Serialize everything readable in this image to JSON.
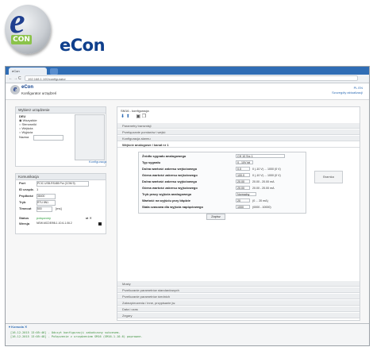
{
  "brand": {
    "logo_letter": "e",
    "logo_badge": "CON",
    "name": "eCon"
  },
  "browser": {
    "tab_title": "eCon",
    "address": "192.168.1.100/configurator",
    "nav": {
      "back": "←",
      "forward": "→",
      "reload": "C"
    }
  },
  "app": {
    "title": "eCon",
    "subtitle": "Konfigurator urządzeń",
    "top_right_1": "PL  EN",
    "top_right_2": "Szczegóły aktualizacji"
  },
  "left_panel": {
    "title": "Wybierz urządzenie",
    "device_label": "DEU",
    "options": [
      "Wszystkie",
      "Sterowniki",
      "Wejścia",
      "Wyjścia"
    ],
    "search_label": "Nazwa",
    "more_link": "Konfiguracja"
  },
  "comm_panel": {
    "title": "Komunikacja",
    "rows": [
      {
        "label": "Port",
        "value": "PCIC USB-RS485 Por (COM 9)"
      },
      {
        "label": "ID urządz.",
        "value": "1"
      },
      {
        "label": "Prędkość",
        "value": "38400"
      },
      {
        "label": "Tryb",
        "value": "RTU 8N1"
      },
      {
        "label": "Timeout",
        "value": "500",
        "unit": "[ms]"
      }
    ],
    "status_label": "Status",
    "status_value": "połączony",
    "version_label": "Wersja",
    "version_value": "NEW-MCDEI98-1.10.6-1.06.2"
  },
  "right": {
    "header": "SM16 - konfiguracja",
    "sections_top": [
      "Parametry transmisji",
      "Przełączanie pomiarów i wejść",
      "Konfiguracja alarmu",
      "Wejście analogowe / kanał nr 1"
    ],
    "config_rows": [
      {
        "label": "Źródło sygnału analogowego",
        "value": "CH 10 Src 1"
      },
      {
        "label": "Typ sygnału",
        "value": "0...10V bit"
      },
      {
        "label": "Dolna wartość zakresu wejściowego",
        "value": "0.0",
        "range": "0 (-10 V) ... 1000 (0 V)"
      },
      {
        "label": "Górna wartość zakresu wejściowego",
        "value": "100.0",
        "range": "0 (-10 V) ... 1000 (0 V)"
      },
      {
        "label": "Dolna wartość zakresu wyjściowego",
        "value": "20.00",
        "range": "20.00 - 20.00 mA"
      },
      {
        "label": "Górna wartość zakresu wyjściowego",
        "value": "20.00",
        "range": "20.00 - 20.00 mA"
      },
      {
        "label": "Tryb pracy wyjścia analogowego",
        "value": "Normalny"
      },
      {
        "label": "Wartość na wyjściu przy błędzie",
        "value": "20",
        "range": "(0 ... 20 mA)"
      },
      {
        "label": "Stała czasowa dla wyjścia napięciowego",
        "value": "1000",
        "range": "(0000 - 10000)"
      }
    ],
    "side_button": "Bramka",
    "save_button": "Zapisz",
    "sections_bottom": [
      "Mosty",
      "Przeliczanie parametrów standardowych",
      "Przeliczanie parametrów średnich",
      "Zabezpieczenia / inne, przypisanie jw.",
      "Data i czas",
      "Zegary"
    ]
  },
  "console": {
    "title": "Konsola",
    "lines": [
      "[16-12-2015 13:05:46] - Odczyt konfiguracji zakończony sukcesem.",
      "[16-12-2015 13:05:48] - Połączenie z urządzeniem SM16 (SM16-1.10.6) poprawne."
    ]
  },
  "colors": {
    "brand_blue": "#0f3f8c",
    "tab_blue": "#2f6db5",
    "status_green": "#2a9d3a",
    "con_green": "#8bc34a"
  }
}
